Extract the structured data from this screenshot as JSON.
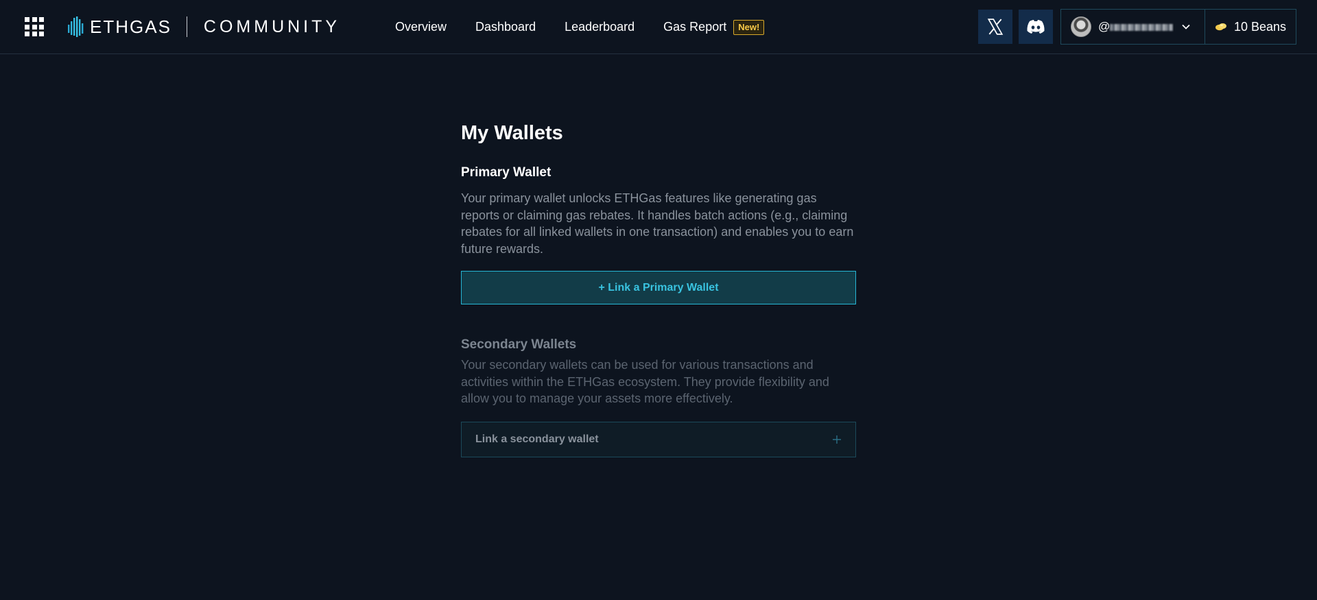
{
  "header": {
    "logo_text": "ETHGAS",
    "logo_suffix": "COMMUNITY",
    "nav": [
      {
        "label": "Overview"
      },
      {
        "label": "Dashboard"
      },
      {
        "label": "Leaderboard"
      },
      {
        "label": "Gas Report",
        "badge": "New!"
      }
    ],
    "social": [
      "x-icon",
      "discord-icon"
    ],
    "user": {
      "handle_prefix": "@"
    },
    "beans": {
      "label": "10 Beans"
    },
    "colors": {
      "accent": "#26b7d6",
      "badge": "#f7c948",
      "social_bg": "#132c4a"
    }
  },
  "main": {
    "title": "My Wallets",
    "primary": {
      "title": "Primary Wallet",
      "description": "Your primary wallet unlocks ETHGas features like generating gas reports or claiming gas rebates. It handles batch actions (e.g., claiming rebates for all linked wallets in one transaction) and enables you to earn future rewards.",
      "button_label": "+ Link a Primary Wallet"
    },
    "secondary": {
      "title": "Secondary Wallets",
      "description": "Your secondary wallets can be used for various transactions and activities within the ETHGas ecosystem. They provide flexibility and allow you to manage your assets more effectively.",
      "button_label": "Link a secondary wallet"
    }
  }
}
